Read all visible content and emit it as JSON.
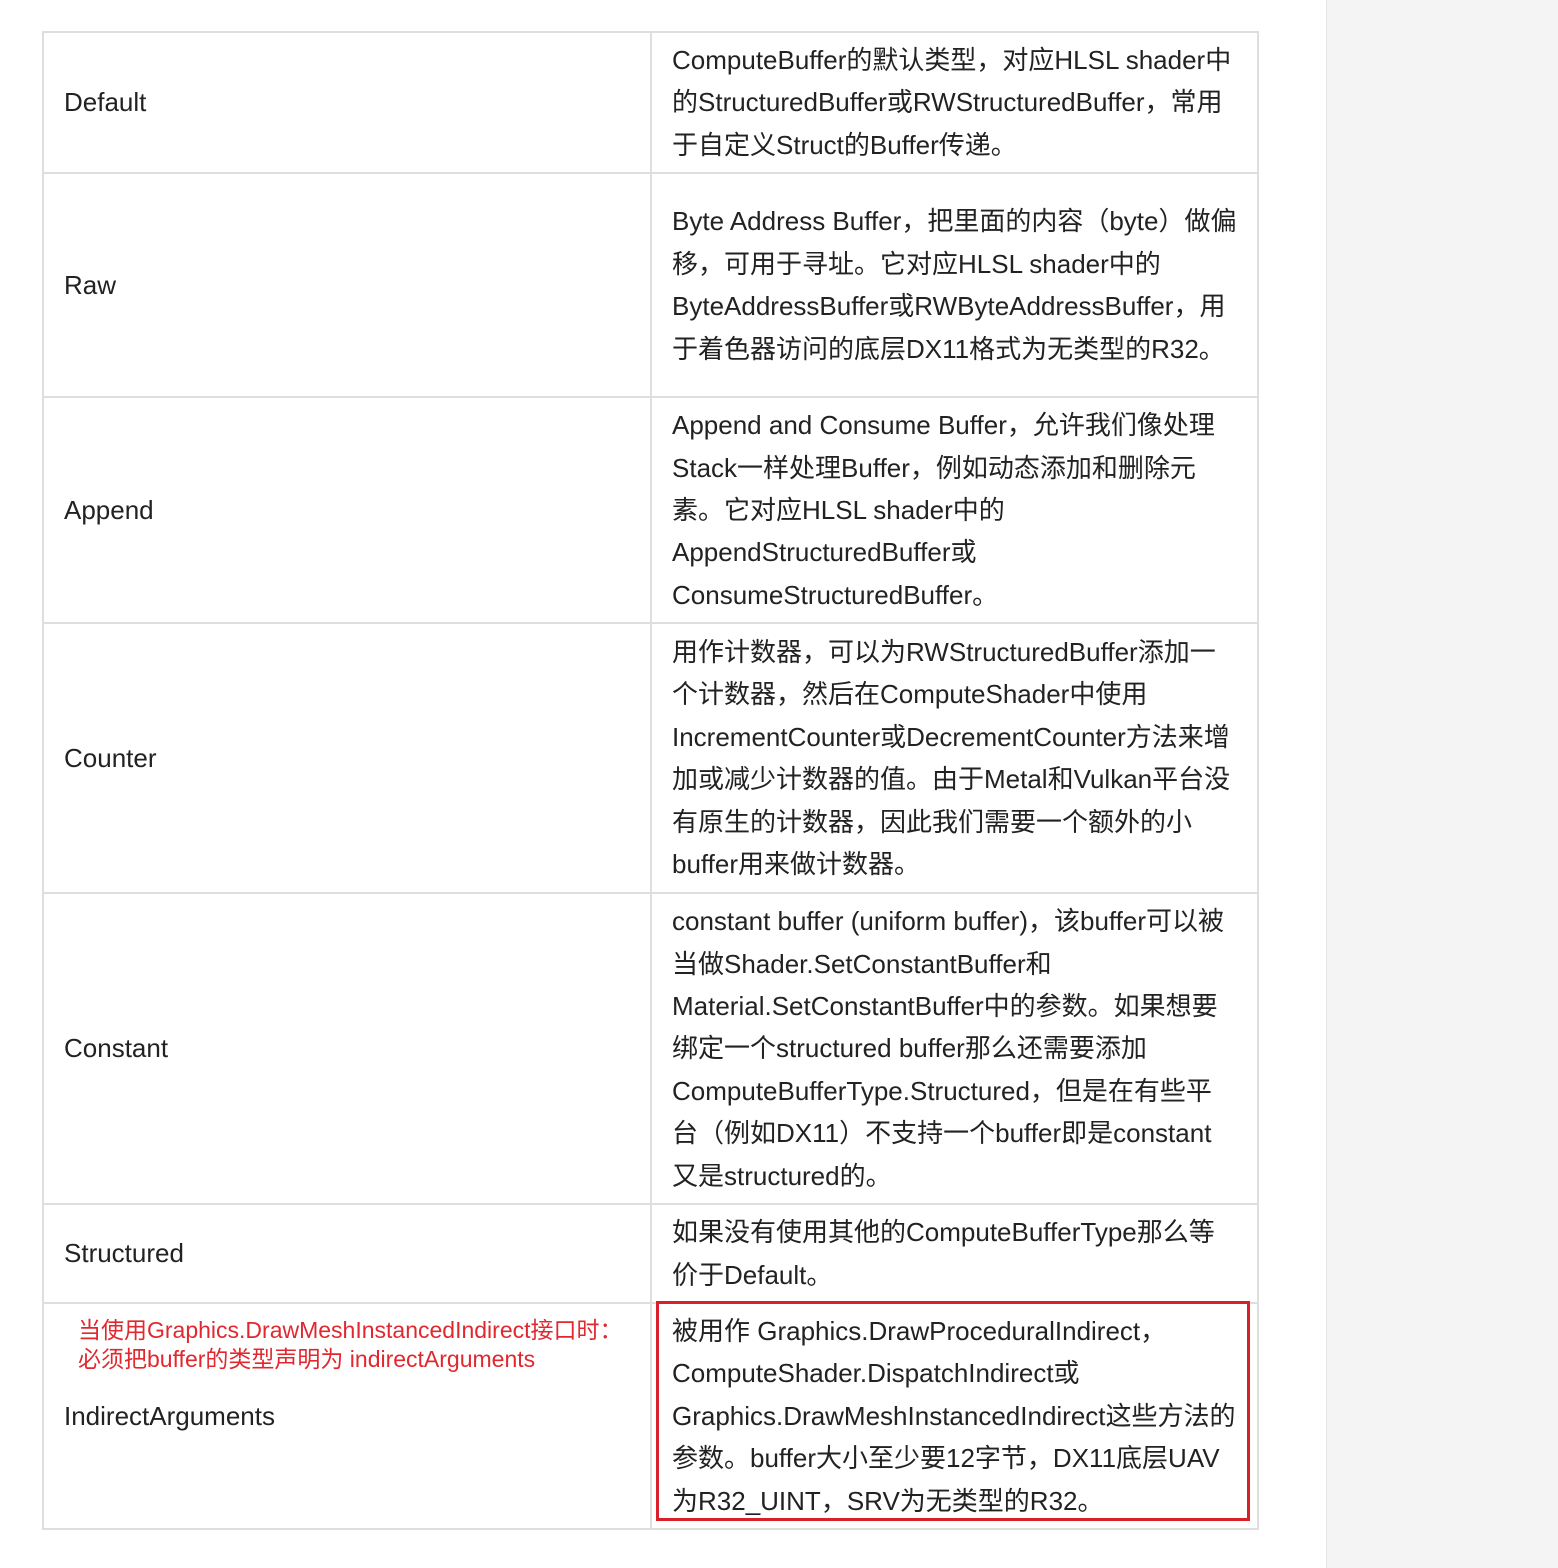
{
  "table": {
    "rows": [
      {
        "name": "Default",
        "description": "ComputeBuffer的默认类型，对应HLSL shader中的StructuredBuffer或RWStructuredBuffer，常用于自定义Struct的Buffer传递。"
      },
      {
        "name": "Raw",
        "description": "Byte Address Buffer，把里面的内容（byte）做偏移，可用于寻址。它对应HLSL shader中的ByteAddressBuffer或RWByteAddressBuffer，用于着色器访问的底层DX11格式为无类型的R32。"
      },
      {
        "name": "Append",
        "description": "Append and Consume Buffer，允许我们像处理Stack一样处理Buffer，例如动态添加和删除元素。它对应HLSL shader中的AppendStructuredBuffer或ConsumeStructuredBuffer。"
      },
      {
        "name": "Counter",
        "description": "用作计数器，可以为RWStructuredBuffer添加一个计数器，然后在ComputeShader中使用IncrementCounter或DecrementCounter方法来增加或减少计数器的值。由于Metal和Vulkan平台没有原生的计数器，因此我们需要一个额外的小buffer用来做计数器。"
      },
      {
        "name": "Constant",
        "description": "constant buffer (uniform buffer)，该buffer可以被当做Shader.SetConstantBuffer和Material.SetConstantBuffer中的参数。如果想要绑定一个structured buffer那么还需要添加ComputeBufferType.Structured，但是在有些平台（例如DX11）不支持一个buffer即是constant又是structured的。"
      },
      {
        "name": "Structured",
        "description": "如果没有使用其他的ComputeBufferType那么等价于Default。"
      },
      {
        "name": "IndirectArguments",
        "description": "被用作 Graphics.DrawProceduralIndirect，ComputeShader.DispatchIndirect或Graphics.DrawMeshInstancedIndirect这些方法的参数。buffer大小至少要12字节，DX11底层UAV为R32_UINT，SRV为无类型的R32。",
        "annotation_line1": "当使用Graphics.DrawMeshInstancedIndirect接口时：",
        "annotation_line2": "必须把buffer的类型声明为 indirectArguments"
      }
    ]
  },
  "colors": {
    "annotation": "#e0282e",
    "highlight_border": "#d9202a",
    "table_border": "#dedede",
    "text": "#222222"
  }
}
